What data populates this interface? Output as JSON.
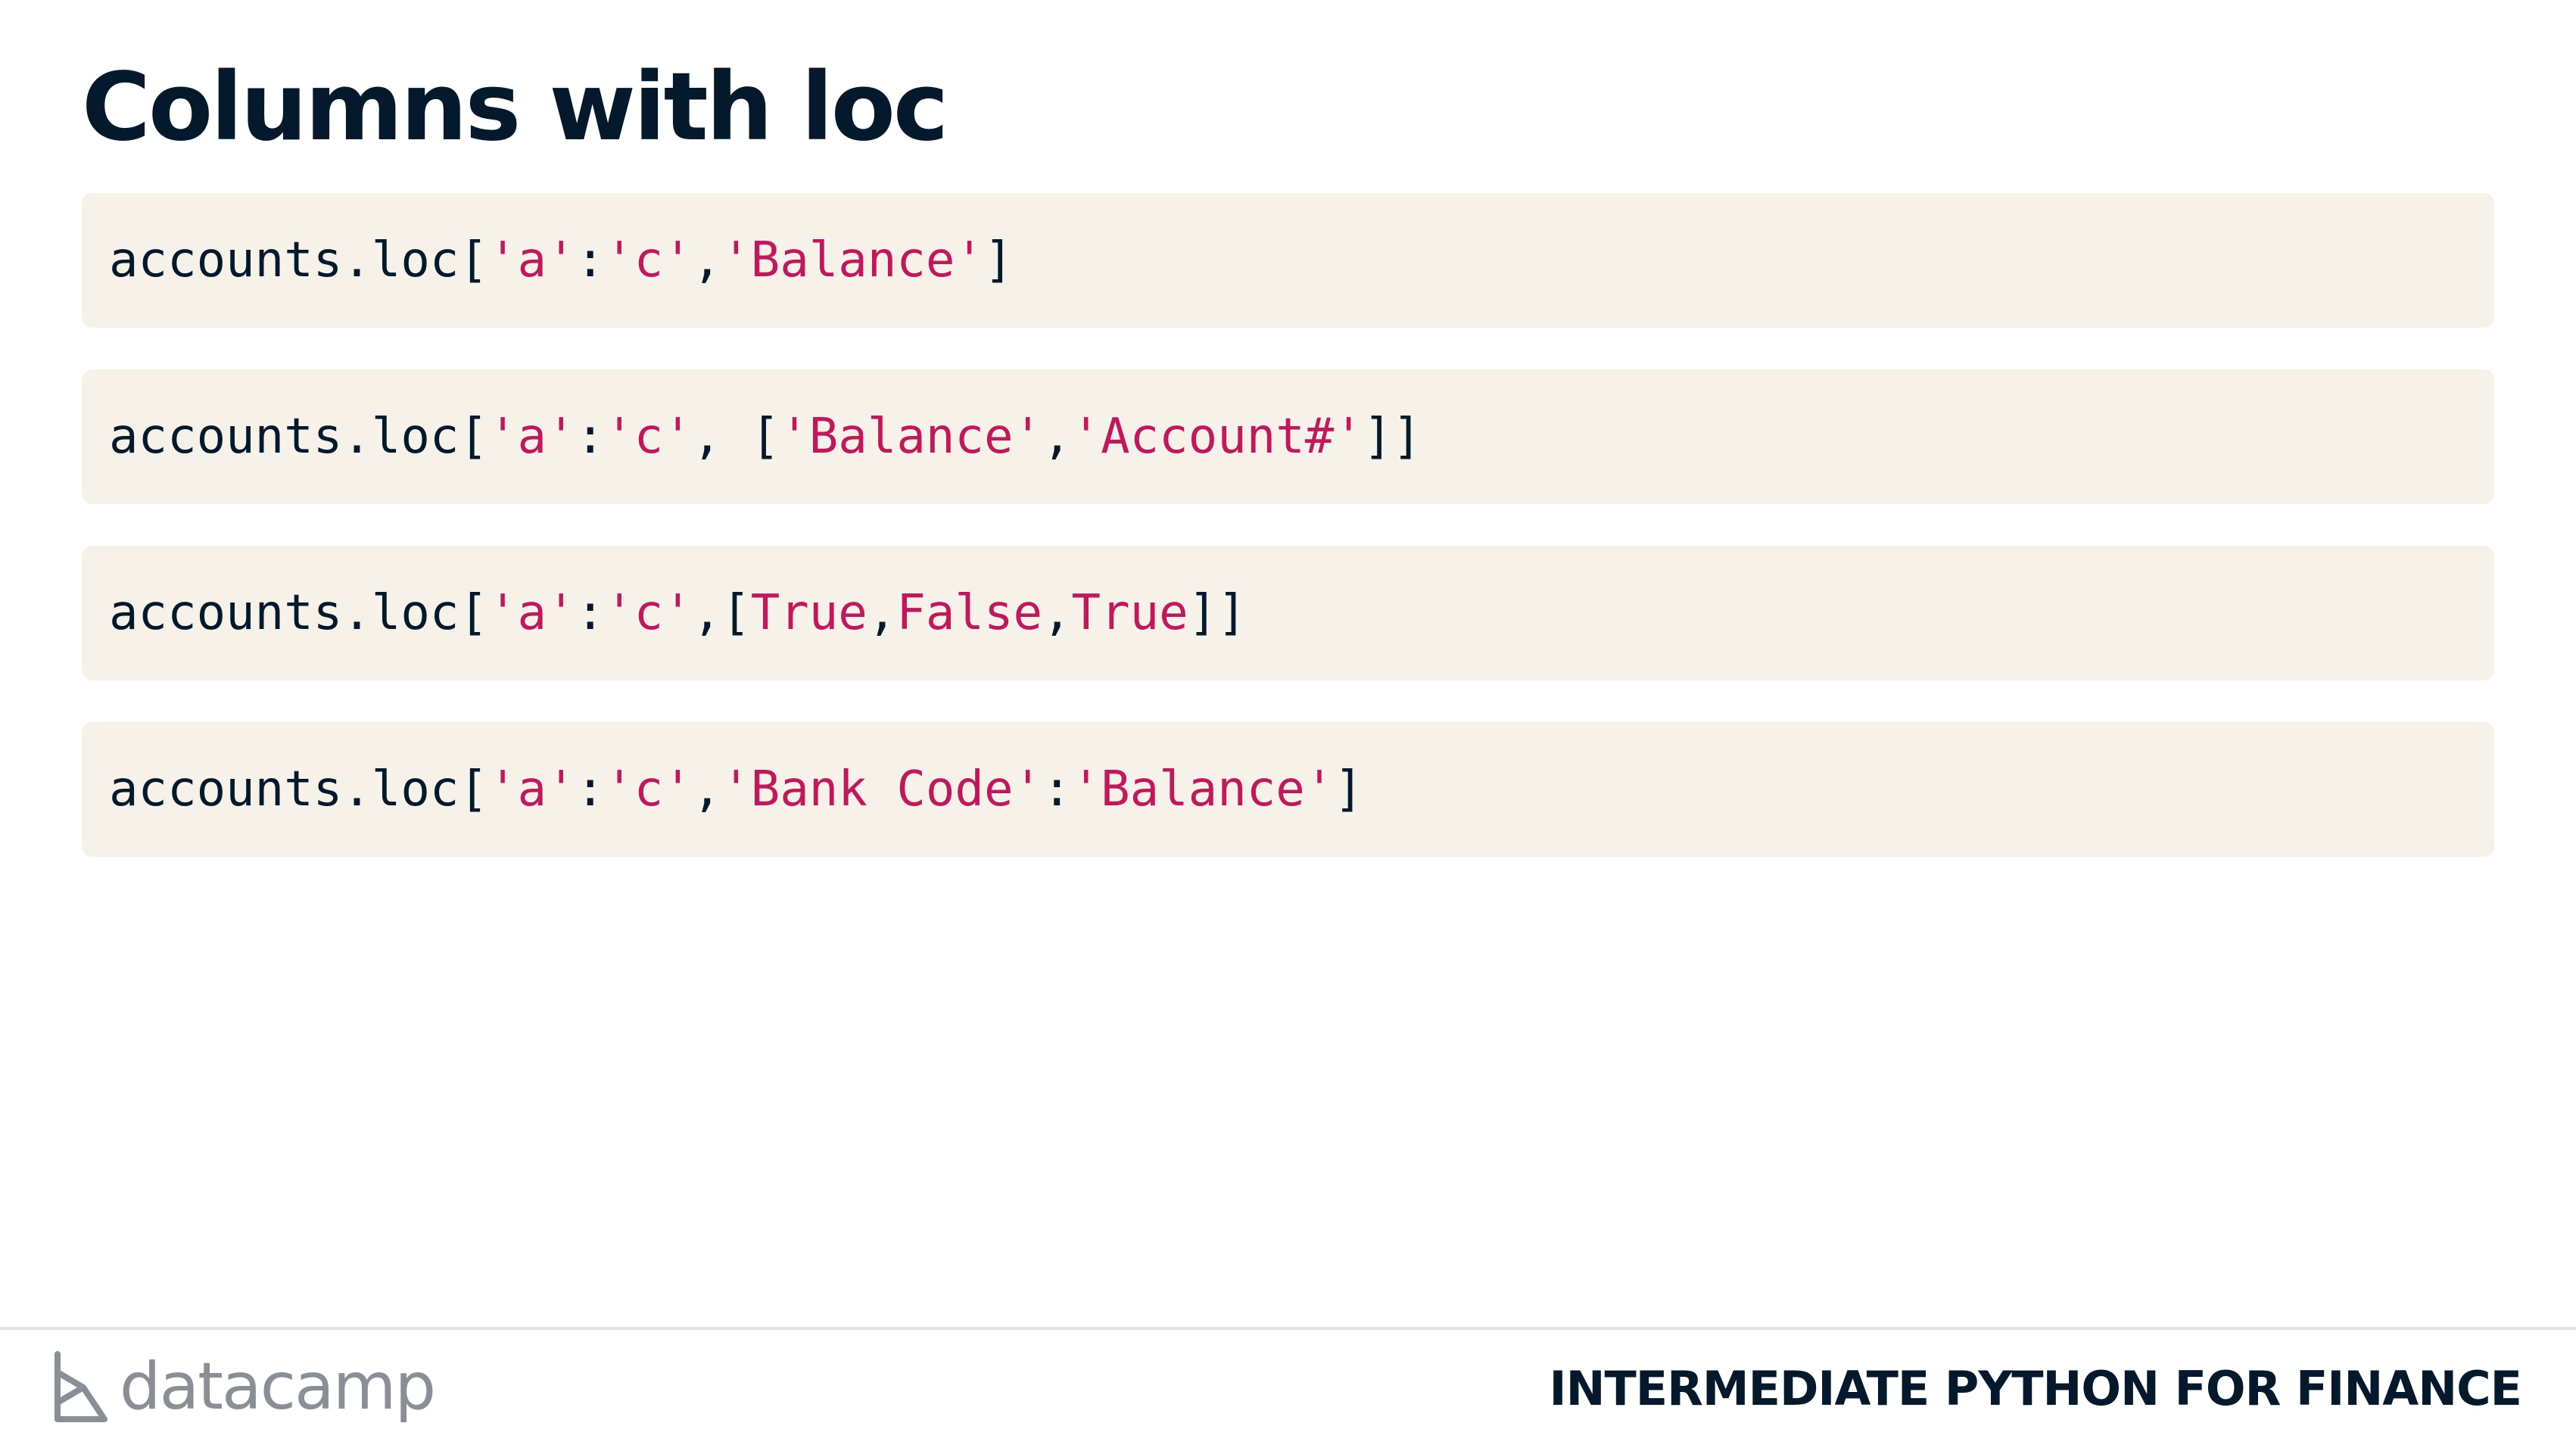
{
  "slide": {
    "title": "Columns with loc"
  },
  "code_blocks": [
    {
      "tokens": [
        {
          "text": "accounts.loc[",
          "kind": "pl"
        },
        {
          "text": "'a'",
          "kind": "str"
        },
        {
          "text": ":",
          "kind": "pl"
        },
        {
          "text": "'c'",
          "kind": "str"
        },
        {
          "text": ",",
          "kind": "pl"
        },
        {
          "text": "'Balance'",
          "kind": "str"
        },
        {
          "text": "]",
          "kind": "pl"
        }
      ]
    },
    {
      "tokens": [
        {
          "text": "accounts.loc[",
          "kind": "pl"
        },
        {
          "text": "'a'",
          "kind": "str"
        },
        {
          "text": ":",
          "kind": "pl"
        },
        {
          "text": "'c'",
          "kind": "str"
        },
        {
          "text": ", [",
          "kind": "pl"
        },
        {
          "text": "'Balance'",
          "kind": "str"
        },
        {
          "text": ",",
          "kind": "pl"
        },
        {
          "text": "'Account#'",
          "kind": "str"
        },
        {
          "text": "]]",
          "kind": "pl"
        }
      ]
    },
    {
      "tokens": [
        {
          "text": "accounts.loc[",
          "kind": "pl"
        },
        {
          "text": "'a'",
          "kind": "str"
        },
        {
          "text": ":",
          "kind": "pl"
        },
        {
          "text": "'c'",
          "kind": "str"
        },
        {
          "text": ",[",
          "kind": "pl"
        },
        {
          "text": "True",
          "kind": "kw"
        },
        {
          "text": ",",
          "kind": "pl"
        },
        {
          "text": "False",
          "kind": "kw"
        },
        {
          "text": ",",
          "kind": "pl"
        },
        {
          "text": "True",
          "kind": "kw"
        },
        {
          "text": "]]",
          "kind": "pl"
        }
      ]
    },
    {
      "tokens": [
        {
          "text": "accounts.loc[",
          "kind": "pl"
        },
        {
          "text": "'a'",
          "kind": "str"
        },
        {
          "text": ":",
          "kind": "pl"
        },
        {
          "text": "'c'",
          "kind": "str"
        },
        {
          "text": ",",
          "kind": "pl"
        },
        {
          "text": "'Bank Code'",
          "kind": "str"
        },
        {
          "text": ":",
          "kind": "pl"
        },
        {
          "text": "'Balance'",
          "kind": "str"
        },
        {
          "text": "]",
          "kind": "pl"
        }
      ]
    }
  ],
  "footer": {
    "logo_text": "datacamp",
    "course_name": "INTERMEDIATE PYTHON FOR FINANCE"
  },
  "colors": {
    "title": "#05192d",
    "code_background": "#f6f2ea",
    "string_literal": "#c2185b",
    "logo_gray": "#8a8f96"
  }
}
